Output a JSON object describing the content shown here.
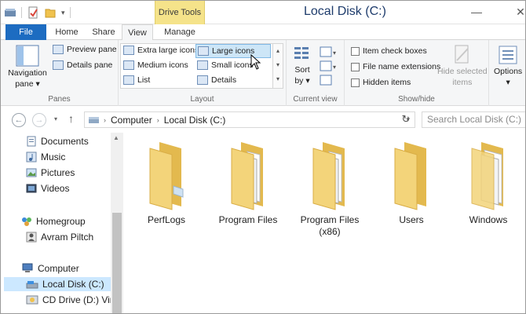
{
  "titlebar": {
    "drive_tools": "Drive Tools",
    "title": "Local Disk (C:)",
    "minimize_glyph": "—",
    "close_glyph": "✕"
  },
  "tabs": [
    {
      "label": "File"
    },
    {
      "label": "Home"
    },
    {
      "label": "Share"
    },
    {
      "label": "View"
    },
    {
      "label": "Manage"
    }
  ],
  "ribbon": {
    "panes": {
      "label": "Panes",
      "navigation_pane_line1": "Navigation",
      "navigation_pane_line2": "pane",
      "preview_pane": "Preview pane",
      "details_pane": "Details pane"
    },
    "layout": {
      "label": "Layout",
      "extra_large": "Extra large icons",
      "large": "Large icons",
      "medium": "Medium icons",
      "small": "Small icons",
      "list": "List",
      "details": "Details"
    },
    "current_view": {
      "label": "Current view",
      "sort_line1": "Sort",
      "sort_line2": "by"
    },
    "show_hide": {
      "label": "Show/hide",
      "item_check_boxes": "Item check boxes",
      "file_name_extensions": "File name extensions",
      "hidden_items": "Hidden items",
      "hide_selected_line1": "Hide selected",
      "hide_selected_line2": "items"
    },
    "options": "Options"
  },
  "address": {
    "crumb_computer": "Computer",
    "crumb_disk": "Local Disk (C:)",
    "search_placeholder": "Search Local Disk (C:)"
  },
  "navpane": {
    "items": [
      {
        "label": "Documents"
      },
      {
        "label": "Music"
      },
      {
        "label": "Pictures"
      },
      {
        "label": "Videos"
      },
      {
        "label": "Homegroup"
      },
      {
        "label": "Avram Piltch"
      },
      {
        "label": "Computer"
      },
      {
        "label": "Local Disk (C:)"
      },
      {
        "label": "CD Drive (D:) Virtu"
      }
    ]
  },
  "folders": [
    {
      "line1": "PerfLogs",
      "line2": ""
    },
    {
      "line1": "Program Files",
      "line2": ""
    },
    {
      "line1": "Program Files",
      "line2": "(x86)"
    },
    {
      "line1": "Users",
      "line2": ""
    },
    {
      "line1": "Windows",
      "line2": ""
    }
  ],
  "colors": {
    "accent": "#1d6cc1",
    "drive_tools_bg": "#f5e38a",
    "folder_front": "#f3d47a",
    "folder_back": "#e3b94e",
    "selection": "#cce8ff"
  }
}
